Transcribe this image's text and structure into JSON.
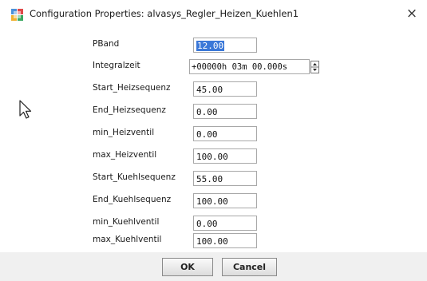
{
  "window": {
    "title": "Configuration Properties: alvasys_Regler_Heizen_Kuehlen1",
    "close_glyph": "×"
  },
  "properties": [
    {
      "label": "PBand",
      "value": "12.00",
      "selected": true
    },
    {
      "label": "Integralzeit",
      "value": "+00000h 03m 00.000s",
      "kind": "time"
    },
    {
      "label": "Start_Heizsequenz",
      "value": "45.00"
    },
    {
      "label": "End_Heizsequenz",
      "value": "0.00"
    },
    {
      "label": "min_Heizventil",
      "value": "0.00"
    },
    {
      "label": "max_Heizventil",
      "value": "100.00"
    },
    {
      "label": "Start_Kuehlsequenz",
      "value": "55.00"
    },
    {
      "label": "End_Kuehlsequenz",
      "value": "100.00"
    },
    {
      "label": "min_Kuehlventil",
      "value": "0.00"
    },
    {
      "label": "max_Kuehlventil",
      "value": "100.00"
    }
  ],
  "buttons": {
    "ok_label": "OK",
    "cancel_label": "Cancel"
  },
  "colors": {
    "selection": "#3b78d8",
    "button_bar": "#f0f0f0"
  },
  "icons": {
    "app": "config-app-icon",
    "close": "close-icon",
    "spin": "spinner-icon",
    "cursor": "mouse-pointer-icon"
  }
}
